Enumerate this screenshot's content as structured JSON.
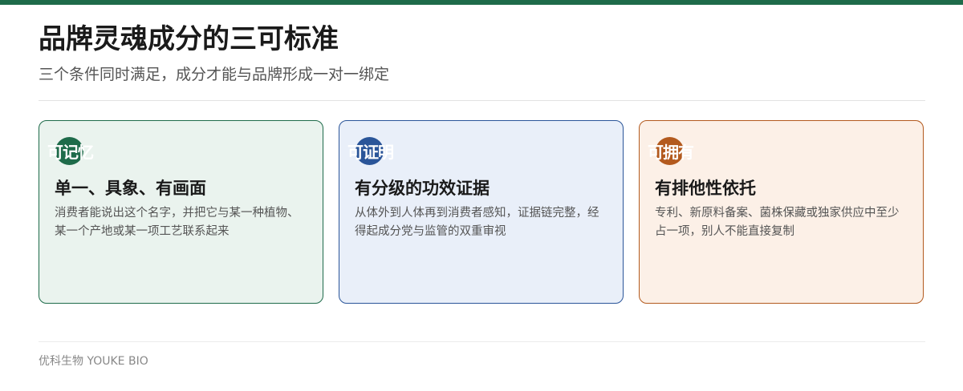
{
  "header": {
    "title": "品牌灵魂成分的三可标准",
    "subtitle": "三个条件同时满足，成分才能与品牌形成一对一绑定"
  },
  "colors": {
    "accent_bar": "#1e6b4a",
    "green": "#1e6b4a",
    "blue": "#2a5599",
    "orange": "#b35a1e"
  },
  "cards": [
    {
      "badge": "可记忆",
      "title": "单一、具象、有画面",
      "desc": "消费者能说出这个名字，并把它与某一种植物、某一个产地或某一项工艺联系起来"
    },
    {
      "badge": "可证明",
      "title": "有分级的功效证据",
      "desc": "从体外到人体再到消费者感知，证据链完整，经得起成分党与监管的双重审视"
    },
    {
      "badge": "可拥有",
      "title": "有排他性依托",
      "desc": "专利、新原料备案、菌株保藏或独家供应中至少占一项，别人不能直接复制"
    }
  ],
  "footer": {
    "brand": "优科生物 YOUKE BIO"
  }
}
